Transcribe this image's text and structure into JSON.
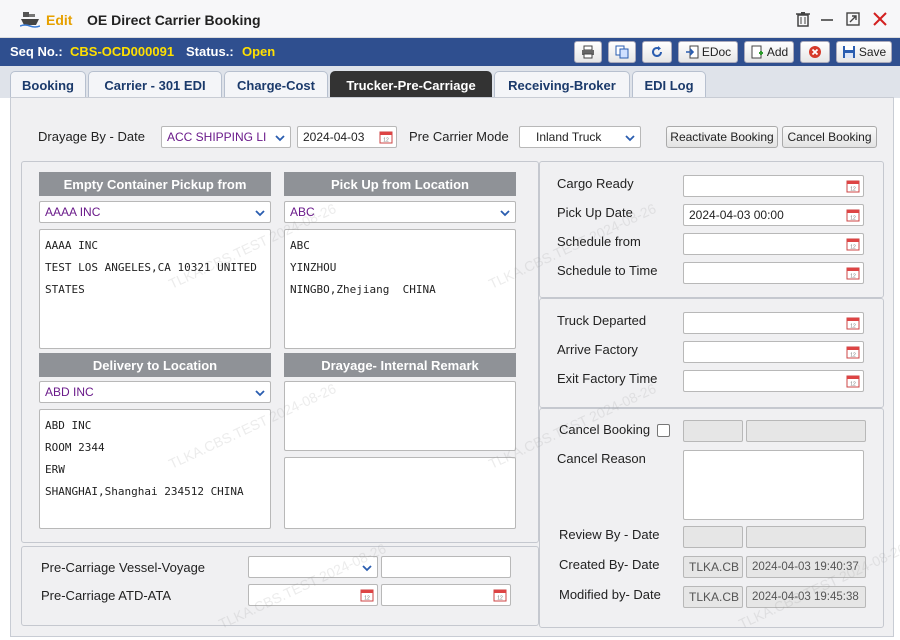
{
  "window": {
    "edit_label": "Edit",
    "title": "OE Direct Carrier Booking"
  },
  "header": {
    "seq_label": "Seq No.:",
    "seq_value": "CBS-OCD000091",
    "status_label": "Status.:",
    "status_value": "Open",
    "edoc_label": "EDoc",
    "add_label": "Add",
    "save_label": "Save"
  },
  "tabs": [
    {
      "label": "Booking"
    },
    {
      "label": "Carrier - 301 EDI"
    },
    {
      "label": "Charge-Cost"
    },
    {
      "label": "Trucker-Pre-Carriage"
    },
    {
      "label": "Receiving-Broker"
    },
    {
      "label": "EDI Log"
    }
  ],
  "top": {
    "drayage_label": "Drayage By - Date",
    "drayage_value": "ACC SHIPPING LI",
    "drayage_date": "2024-04-03",
    "pre_carrier_mode_label": "Pre Carrier Mode",
    "pre_carrier_mode_value": "Inland Truck",
    "reactivate_label": "Reactivate Booking",
    "cancel_label": "Cancel Booking"
  },
  "empty_pickup": {
    "header": "Empty Container Pickup from",
    "select": "AAAA INC",
    "address": "AAAA INC\nTEST LOS ANGELES,CA 10321 UNITED\nSTATES"
  },
  "pickup_location": {
    "header": "Pick Up from Location",
    "select": "ABC",
    "address": "ABC\nYINZHOU\nNINGBO,Zhejiang  CHINA"
  },
  "delivery": {
    "header": "Delivery to Location",
    "select": "ABD INC",
    "address": "ABD INC\nROOM 2344\nERW\nSHANGHAI,Shanghai 234512 CHINA"
  },
  "remark": {
    "header": "Drayage- Internal Remark"
  },
  "bottom": {
    "vessel_label": "Pre-Carriage Vessel-Voyage",
    "atd_label": "Pre-Carriage ATD-ATA"
  },
  "right1": {
    "cargo_ready": "Cargo Ready",
    "pickup_date": "Pick Up Date",
    "pickup_date_value": "2024-04-03 00:00",
    "schedule_from": "Schedule from",
    "schedule_to": "Schedule to Time"
  },
  "right2": {
    "truck_departed": "Truck Departed",
    "arrive_factory": "Arrive Factory",
    "exit_factory": "Exit Factory Time"
  },
  "right3": {
    "cancel_booking": "Cancel Booking",
    "cancel_reason": "Cancel Reason",
    "review_by": "Review By - Date",
    "created_by": "Created By- Date",
    "created_user": "TLKA.CB",
    "created_date": "2024-04-03 19:40:37",
    "modified_by": "Modified by- Date",
    "modified_user": "TLKA.CB",
    "modified_date": "2024-04-03 19:45:38"
  },
  "watermark": "TLKA.CBS.TEST 2024-08-26"
}
